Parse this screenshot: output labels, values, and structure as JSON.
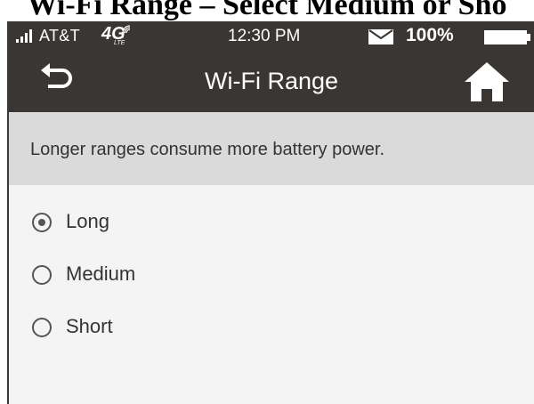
{
  "doc_heading": "Wi-Fi Range – Select Medium or Sho",
  "status_bar": {
    "carrier": "AT&T",
    "network": "4G",
    "network_sub": "LTE",
    "time": "12:30 PM",
    "battery_percent": "100%",
    "battery_level": 1.0
  },
  "title_bar": {
    "title": "Wi-Fi Range",
    "back_icon": "back-arrow-icon",
    "home_icon": "home-icon"
  },
  "info": {
    "message": "Longer ranges consume more battery power."
  },
  "range_options": [
    {
      "label": "Long",
      "selected": true
    },
    {
      "label": "Medium",
      "selected": false
    },
    {
      "label": "Short",
      "selected": false
    }
  ],
  "colors": {
    "bar": "#3a3633",
    "banner": "#dadada",
    "content": "#f4f4f4"
  }
}
